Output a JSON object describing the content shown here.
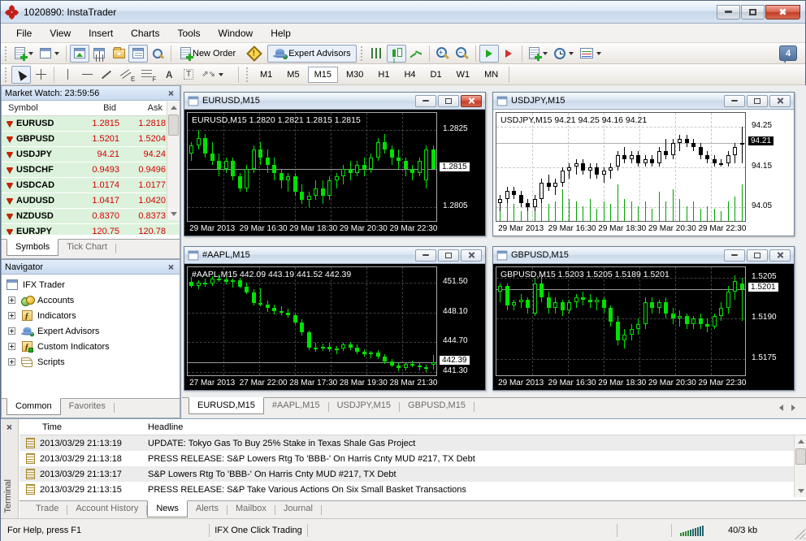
{
  "window": {
    "title": "1020890: InstaTrader"
  },
  "menu": {
    "items": [
      "File",
      "View",
      "Insert",
      "Charts",
      "Tools",
      "Window",
      "Help"
    ]
  },
  "toolbar": {
    "new_order_label": "New Order",
    "expert_advisors_label": "Expert Advisors",
    "notification_count": "4",
    "timeframes": {
      "items": [
        "M1",
        "M5",
        "M15",
        "M30",
        "H1",
        "H4",
        "D1",
        "W1",
        "MN"
      ],
      "active": "M15"
    }
  },
  "icons": {
    "warning_mark": "!",
    "favorites_star": "★",
    "text_tool": "A",
    "text_label_tool": "T",
    "channel_sub": "E",
    "fib_sub": "F",
    "function_f": "ƒ",
    "arrows_tool": "⇗⇘"
  },
  "market_watch": {
    "title": "Market Watch: 23:59:56",
    "columns": [
      "Symbol",
      "Bid",
      "Ask"
    ],
    "rows": [
      {
        "symbol": "EURUSD",
        "bid": "1.2815",
        "ask": "1.2818"
      },
      {
        "symbol": "GBPUSD",
        "bid": "1.5201",
        "ask": "1.5204"
      },
      {
        "symbol": "USDJPY",
        "bid": "94.21",
        "ask": "94.24"
      },
      {
        "symbol": "USDCHF",
        "bid": "0.9493",
        "ask": "0.9496"
      },
      {
        "symbol": "USDCAD",
        "bid": "1.0174",
        "ask": "1.0177"
      },
      {
        "symbol": "AUDUSD",
        "bid": "1.0417",
        "ask": "1.0420"
      },
      {
        "symbol": "NZDUSD",
        "bid": "0.8370",
        "ask": "0.8373"
      },
      {
        "symbol": "EURJPY",
        "bid": "120.75",
        "ask": "120.78"
      }
    ],
    "tabs": [
      "Symbols",
      "Tick Chart"
    ],
    "active_tab": "Symbols"
  },
  "navigator": {
    "title": "Navigator",
    "root": "IFX Trader",
    "items": [
      "Accounts",
      "Indicators",
      "Expert Advisors",
      "Custom Indicators",
      "Scripts"
    ],
    "tabs": [
      "Common",
      "Favorites"
    ],
    "active_tab": "Common"
  },
  "chart_tabs": {
    "items": [
      "EURUSD,M15",
      "#AAPL,M15",
      "USDJPY,M15",
      "GBPUSD,M15"
    ],
    "active": "EURUSD,M15"
  },
  "terminal": {
    "label": "Terminal",
    "columns": [
      "Time",
      "Headline"
    ],
    "news": [
      {
        "time": "2013/03/29 21:13:19",
        "headline": "UPDATE: Tokyo Gas To Buy 25% Stake in Texas Shale Gas Project"
      },
      {
        "time": "2013/03/29 21:13:18",
        "headline": "PRESS RELEASE: S&P Lowers Rtg To 'BBB-' On Harris Cnty MUD #217, TX Debt"
      },
      {
        "time": "2013/03/29 21:13:17",
        "headline": "S&P Lowers Rtg To 'BBB-' On Harris Cnty MUD #217, TX Debt"
      },
      {
        "time": "2013/03/29 21:13:15",
        "headline": "PRESS RELEASE: S&P Take Various Actions On Six Small Basket Transactions"
      }
    ],
    "tabs": [
      "Trade",
      "Account History",
      "News",
      "Alerts",
      "Mailbox",
      "Journal"
    ],
    "active_tab": "News"
  },
  "status_bar": {
    "help": "For Help, press F1",
    "mode": "IFX One Click Trading",
    "traffic": "40/3 kb"
  },
  "colors": {
    "quote_bg_green": "#dcf2dc",
    "quote_red": "#d40000",
    "chart_lime": "#00e100",
    "close_red": "#c03a24",
    "panel_header_blue": "#c8daef"
  },
  "chart_data": [
    {
      "id": "eurusd",
      "type": "candlestick",
      "title": "EURUSD,M15",
      "theme": "dark",
      "active": true,
      "info": "EURUSD,M15 1.2820 1.2821 1.2815 1.2815",
      "ylim": [
        1.28015,
        1.28295
      ],
      "y_ticks": [
        "1.2825",
        "1.2815",
        "1.2805"
      ],
      "current": "1.2815",
      "x_ticks": [
        "29 Mar 2013",
        "29 Mar 16:30",
        "29 Mar 18:30",
        "29 Mar 20:30",
        "29 Mar 22:30"
      ],
      "candles": [
        [
          1.2819,
          1.2822,
          1.2817,
          1.2821
        ],
        [
          1.2821,
          1.2825,
          1.282,
          1.2823
        ],
        [
          1.2823,
          1.2824,
          1.2818,
          1.2819
        ],
        [
          1.2819,
          1.2822,
          1.2816,
          1.2817
        ],
        [
          1.2817,
          1.2819,
          1.2813,
          1.2815
        ],
        [
          1.2815,
          1.2818,
          1.2814,
          1.2817
        ],
        [
          1.2817,
          1.2818,
          1.2812,
          1.2813
        ],
        [
          1.2813,
          1.2814,
          1.2809,
          1.281
        ],
        [
          1.281,
          1.2816,
          1.2809,
          1.2815
        ],
        [
          1.2815,
          1.2821,
          1.2814,
          1.282
        ],
        [
          1.282,
          1.2822,
          1.2816,
          1.2818
        ],
        [
          1.2818,
          1.282,
          1.2814,
          1.2816
        ],
        [
          1.2816,
          1.2818,
          1.2812,
          1.2814
        ],
        [
          1.2814,
          1.2815,
          1.281,
          1.2812
        ],
        [
          1.2812,
          1.2814,
          1.2809,
          1.2813
        ],
        [
          1.2813,
          1.2814,
          1.2808,
          1.2809
        ],
        [
          1.2809,
          1.2811,
          1.2806,
          1.2807
        ],
        [
          1.2807,
          1.2809,
          1.2805,
          1.2808
        ],
        [
          1.2808,
          1.2812,
          1.2807,
          1.281
        ],
        [
          1.281,
          1.2812,
          1.2806,
          1.2808
        ],
        [
          1.2808,
          1.2813,
          1.2807,
          1.2812
        ],
        [
          1.2812,
          1.2814,
          1.281,
          1.2813
        ],
        [
          1.2813,
          1.2816,
          1.2811,
          1.2815
        ],
        [
          1.2815,
          1.2817,
          1.2812,
          1.2814
        ],
        [
          1.2814,
          1.2817,
          1.2813,
          1.2816
        ],
        [
          1.2816,
          1.2818,
          1.2813,
          1.2815
        ],
        [
          1.2815,
          1.2819,
          1.2814,
          1.2818
        ],
        [
          1.2818,
          1.2823,
          1.2817,
          1.2822
        ],
        [
          1.2822,
          1.2824,
          1.2819,
          1.282
        ],
        [
          1.282,
          1.2821,
          1.2816,
          1.2818
        ],
        [
          1.2818,
          1.282,
          1.2815,
          1.2817
        ],
        [
          1.2817,
          1.2818,
          1.2813,
          1.2815
        ],
        [
          1.2815,
          1.2816,
          1.2812,
          1.2814
        ],
        [
          1.2814,
          1.2818,
          1.2813,
          1.2817
        ],
        [
          1.2812,
          1.2821,
          1.281,
          1.282
        ],
        [
          1.282,
          1.2821,
          1.2815,
          1.2815
        ]
      ]
    },
    {
      "id": "usdjpy",
      "type": "candlestick",
      "title": "USDJPY,M15",
      "theme": "light",
      "active": false,
      "info": "USDJPY,M15 94.21 94.25 94.16 94.21",
      "ylim": [
        94.015,
        94.285
      ],
      "y_ticks": [
        "94.25",
        "94.15",
        "94.05"
      ],
      "current": "94.21",
      "x_ticks": [
        "29 Mar 2013",
        "29 Mar 16:30",
        "29 Mar 18:30",
        "29 Mar 20:30",
        "29 Mar 22:30"
      ],
      "candles": [
        [
          94.06,
          94.08,
          94.04,
          94.07
        ],
        [
          94.07,
          94.1,
          94.06,
          94.09
        ],
        [
          94.09,
          94.1,
          94.07,
          94.08
        ],
        [
          94.08,
          94.09,
          94.05,
          94.06
        ],
        [
          94.06,
          94.07,
          94.04,
          94.05
        ],
        [
          94.05,
          94.08,
          94.04,
          94.07
        ],
        [
          94.07,
          94.12,
          94.06,
          94.11
        ],
        [
          94.11,
          94.13,
          94.09,
          94.1
        ],
        [
          94.1,
          94.12,
          94.08,
          94.11
        ],
        [
          94.11,
          94.15,
          94.1,
          94.14
        ],
        [
          94.14,
          94.16,
          94.12,
          94.15
        ],
        [
          94.15,
          94.17,
          94.13,
          94.16
        ],
        [
          94.16,
          94.17,
          94.13,
          94.14
        ],
        [
          94.14,
          94.16,
          94.12,
          94.15
        ],
        [
          94.15,
          94.16,
          94.12,
          94.13
        ],
        [
          94.13,
          94.15,
          94.11,
          94.14
        ],
        [
          94.14,
          94.16,
          94.12,
          94.15
        ],
        [
          94.15,
          94.19,
          94.14,
          94.18
        ],
        [
          94.18,
          94.2,
          94.16,
          94.17
        ],
        [
          94.17,
          94.19,
          94.16,
          94.18
        ],
        [
          94.18,
          94.19,
          94.15,
          94.16
        ],
        [
          94.16,
          94.18,
          94.15,
          94.17
        ],
        [
          94.17,
          94.18,
          94.15,
          94.16
        ],
        [
          94.16,
          94.2,
          94.15,
          94.19
        ],
        [
          94.19,
          94.22,
          94.17,
          94.18
        ],
        [
          94.18,
          94.22,
          94.17,
          94.21
        ],
        [
          94.21,
          94.23,
          94.19,
          94.22
        ],
        [
          94.22,
          94.23,
          94.2,
          94.21
        ],
        [
          94.21,
          94.22,
          94.19,
          94.2
        ],
        [
          94.2,
          94.21,
          94.17,
          94.18
        ],
        [
          94.18,
          94.19,
          94.16,
          94.17
        ],
        [
          94.17,
          94.18,
          94.15,
          94.16
        ],
        [
          94.16,
          94.17,
          94.15,
          94.16
        ],
        [
          94.16,
          94.19,
          94.15,
          94.18
        ],
        [
          94.18,
          94.21,
          94.16,
          94.2
        ],
        [
          94.21,
          94.25,
          94.16,
          94.21
        ]
      ],
      "volumes": [
        6,
        8,
        7,
        4,
        9,
        5,
        12,
        7,
        8,
        13,
        9,
        8,
        6,
        9,
        5,
        8,
        7,
        15,
        9,
        8,
        6,
        8,
        5,
        12,
        8,
        13,
        9,
        6,
        8,
        5,
        6,
        5,
        4,
        8,
        10,
        15
      ]
    },
    {
      "id": "aapl",
      "type": "candlestick",
      "title": "#AAPL,M15",
      "theme": "dark",
      "active": false,
      "info": "#AAPL,M15 442.09 443.19 441.52 442.39",
      "ylim": [
        440.9,
        453.3
      ],
      "y_ticks": [
        "451.50",
        "448.10",
        "444.70",
        "441.30"
      ],
      "current": "442.39",
      "x_ticks": [
        "27 Mar 2013",
        "27 Mar 22:00",
        "28 Mar 17:30",
        "28 Mar 19:30",
        "28 Mar 21:30"
      ],
      "candles": [
        [
          451.6,
          452.2,
          451.0,
          451.2
        ],
        [
          451.2,
          451.8,
          450.8,
          451.5
        ],
        [
          451.5,
          452.0,
          451.1,
          451.4
        ],
        [
          451.4,
          452.3,
          451.2,
          452.0
        ],
        [
          452.0,
          452.5,
          451.6,
          451.9
        ],
        [
          451.9,
          452.2,
          451.3,
          451.6
        ],
        [
          451.6,
          452.0,
          451.0,
          451.8
        ],
        [
          451.8,
          452.1,
          450.9,
          451.1
        ],
        [
          451.1,
          451.5,
          450.2,
          450.4
        ],
        [
          450.4,
          450.8,
          448.9,
          449.2
        ],
        [
          449.2,
          450.9,
          448.8,
          449.0
        ],
        [
          449.0,
          449.5,
          448.2,
          448.6
        ],
        [
          448.6,
          449.0,
          447.9,
          448.3
        ],
        [
          448.3,
          448.8,
          447.8,
          448.1
        ],
        [
          448.1,
          448.5,
          447.5,
          447.8
        ],
        [
          447.8,
          448.0,
          446.8,
          447.0
        ],
        [
          447.0,
          447.3,
          445.5,
          445.8
        ],
        [
          445.8,
          446.0,
          443.8,
          444.1
        ],
        [
          444.1,
          444.6,
          443.6,
          444.0
        ],
        [
          444.0,
          444.5,
          443.7,
          444.2
        ],
        [
          444.2,
          444.6,
          443.6,
          443.9
        ],
        [
          443.9,
          444.3,
          443.3,
          444.0
        ],
        [
          444.0,
          444.6,
          443.7,
          444.4
        ],
        [
          444.4,
          444.7,
          443.8,
          444.1
        ],
        [
          444.1,
          444.4,
          443.3,
          443.6
        ],
        [
          443.6,
          443.9,
          443.0,
          443.3
        ],
        [
          443.3,
          443.7,
          442.9,
          443.5
        ],
        [
          443.5,
          443.8,
          442.8,
          443.0
        ],
        [
          443.0,
          443.3,
          442.2,
          442.5
        ],
        [
          442.5,
          442.8,
          441.8,
          442.0
        ],
        [
          442.0,
          442.3,
          441.4,
          441.7
        ],
        [
          441.7,
          442.4,
          441.5,
          442.2
        ],
        [
          442.2,
          442.6,
          441.8,
          442.0
        ],
        [
          442.0,
          442.3,
          441.5,
          441.8
        ],
        [
          441.8,
          442.1,
          441.3,
          441.6
        ],
        [
          442.09,
          443.19,
          441.52,
          442.39
        ]
      ]
    },
    {
      "id": "gbpusd",
      "type": "candlestick",
      "title": "GBPUSD,M15",
      "theme": "dark",
      "active": false,
      "info": "GBPUSD,M15 1.5203 1.5205 1.5189 1.5201",
      "ylim": [
        1.5169,
        1.5209
      ],
      "y_ticks": [
        "1.5205",
        "1.5190",
        "1.5175"
      ],
      "current": "1.5201",
      "x_ticks": [
        "29 Mar 2013",
        "29 Mar 16:30",
        "29 Mar 18:30",
        "29 Mar 20:30",
        "29 Mar 22:30"
      ],
      "candles": [
        [
          1.52,
          1.5203,
          1.5196,
          1.5202
        ],
        [
          1.5202,
          1.5203,
          1.5193,
          1.5195
        ],
        [
          1.5195,
          1.5197,
          1.5193,
          1.5196
        ],
        [
          1.5196,
          1.5199,
          1.5194,
          1.5197
        ],
        [
          1.5197,
          1.5198,
          1.5192,
          1.5194
        ],
        [
          1.5192,
          1.5205,
          1.5191,
          1.5203
        ],
        [
          1.5203,
          1.5206,
          1.5196,
          1.5198
        ],
        [
          1.5198,
          1.52,
          1.5192,
          1.5194
        ],
        [
          1.5194,
          1.5198,
          1.5192,
          1.5196
        ],
        [
          1.5196,
          1.5197,
          1.5191,
          1.5193
        ],
        [
          1.5193,
          1.5197,
          1.5192,
          1.5196
        ],
        [
          1.5196,
          1.5199,
          1.5194,
          1.5198
        ],
        [
          1.5198,
          1.52,
          1.5195,
          1.5197
        ],
        [
          1.5197,
          1.5199,
          1.5194,
          1.5196
        ],
        [
          1.5196,
          1.5198,
          1.5193,
          1.5197
        ],
        [
          1.5197,
          1.5198,
          1.5192,
          1.5194
        ],
        [
          1.5194,
          1.5195,
          1.5187,
          1.5189
        ],
        [
          1.5189,
          1.5191,
          1.518,
          1.5182
        ],
        [
          1.5182,
          1.5186,
          1.5179,
          1.5184
        ],
        [
          1.5184,
          1.5188,
          1.5182,
          1.5186
        ],
        [
          1.5186,
          1.519,
          1.5184,
          1.5188
        ],
        [
          1.5188,
          1.5198,
          1.5186,
          1.5196
        ],
        [
          1.5196,
          1.5198,
          1.5192,
          1.5194
        ],
        [
          1.5194,
          1.5197,
          1.5192,
          1.5196
        ],
        [
          1.5196,
          1.5198,
          1.519,
          1.5192
        ],
        [
          1.5192,
          1.5194,
          1.5188,
          1.519
        ],
        [
          1.519,
          1.5193,
          1.5187,
          1.5191
        ],
        [
          1.5191,
          1.5192,
          1.5186,
          1.5188
        ],
        [
          1.5188,
          1.5191,
          1.5186,
          1.519
        ],
        [
          1.519,
          1.5192,
          1.5186,
          1.5188
        ],
        [
          1.5188,
          1.519,
          1.5185,
          1.5187
        ],
        [
          1.5187,
          1.5192,
          1.5186,
          1.5191
        ],
        [
          1.5191,
          1.5196,
          1.5189,
          1.5194
        ],
        [
          1.5194,
          1.5202,
          1.5192,
          1.52
        ],
        [
          1.52,
          1.5206,
          1.5197,
          1.5204
        ],
        [
          1.5203,
          1.5205,
          1.5189,
          1.5201
        ]
      ]
    }
  ]
}
